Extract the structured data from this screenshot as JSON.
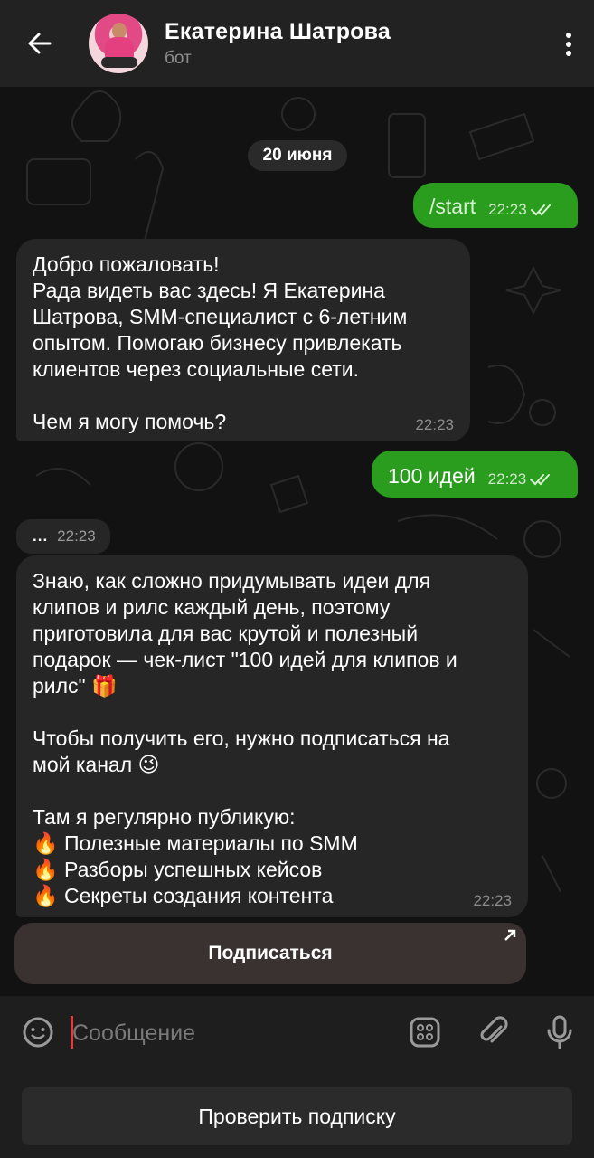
{
  "header": {
    "title": "Екатерина Шатрова",
    "subtitle": "бот"
  },
  "chat": {
    "date": "20 июня",
    "messages": [
      {
        "direction": "out",
        "text": "/start",
        "time": "22:23"
      },
      {
        "direction": "in",
        "text": "Добро пожаловать!\nРада видеть вас здесь! Я Екатерина\nШатрова, SMM-специалист с 6-летним\nопытом. Помогаю бизнесу привлекать\nклиентов через социальные сети.\n\nЧем я могу помочь?",
        "time": "22:23"
      },
      {
        "direction": "out",
        "text": "100 идей",
        "time": "22:23"
      },
      {
        "direction": "in",
        "text": "...",
        "time": "22:23"
      },
      {
        "direction": "in",
        "text": "Знаю, как сложно придумывать идеи для\nклипов и рилс каждый день, поэтому\nприготовила для вас крутой и полезный\nподарок — чек-лист \"100 идей для клипов и\nрилс\" 🎁\n\nЧтобы получить его, нужно подписаться на\nмой канал 😉\n\nТам я регулярно публикую:\n🔥 Полезные материалы по SMM\n🔥 Разборы успешных кейсов\n🔥 Секреты создания контента",
        "time": "22:23"
      }
    ],
    "inline_button": "Подписаться"
  },
  "composer": {
    "placeholder": "Сообщение"
  },
  "keyboard": {
    "button": "Проверить подписку"
  },
  "colors": {
    "outgoing": "#2a9d1f",
    "incoming": "#262626",
    "header": "#222222"
  }
}
